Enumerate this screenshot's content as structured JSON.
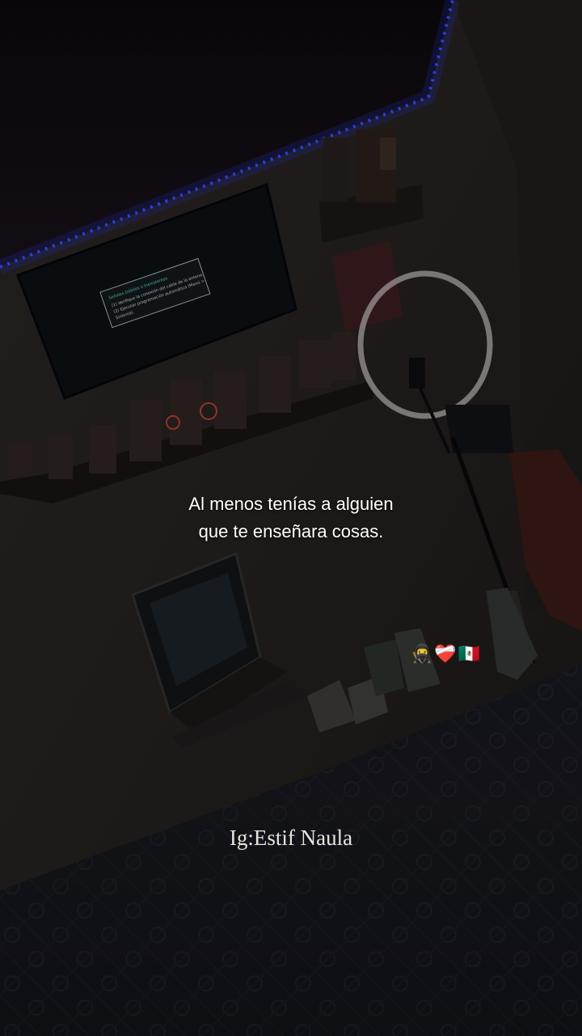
{
  "caption": {
    "line1": "Al menos tenías a alguien",
    "line2": "que te enseñara cosas."
  },
  "emojis": {
    "ninja": "🥷",
    "heart": "❤️‍🩹",
    "flag": "🇲🇽"
  },
  "credit": "Ig:Estif Naula",
  "tv_screen": {
    "heading": "Señales Débiles o Inexistentes",
    "line1": "(1) Verifique la conexión del cable de la antena.",
    "line2": "(2) Ejecutar programación automática (Menú >",
    "line3": "Sintonía)."
  },
  "colors": {
    "led_strip": "#2a3bff",
    "wall": "#2a2523",
    "ceiling": "#120c10",
    "floor": "#15161c",
    "caption_text": "#ffffff"
  }
}
